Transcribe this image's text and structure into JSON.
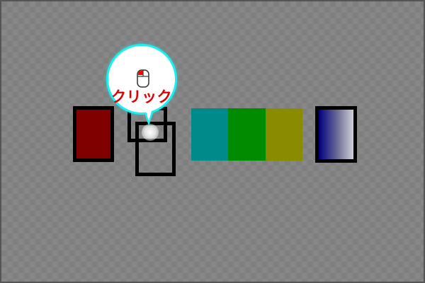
{
  "page": {
    "background_color": "#7f7f7f"
  },
  "tooltip": {
    "label": "クリック",
    "icon": "mouse-icon",
    "border_color": "#19f0f0",
    "text_color": "#e00000"
  },
  "boxes": {
    "red_fill": "#800000",
    "blue_gradient": [
      "#000080",
      "#d0d0da"
    ]
  },
  "color_strip": [
    {
      "name": "teal",
      "color": "#008b8b"
    },
    {
      "name": "green",
      "color": "#008b00"
    },
    {
      "name": "olive",
      "color": "#8b8b00"
    }
  ]
}
